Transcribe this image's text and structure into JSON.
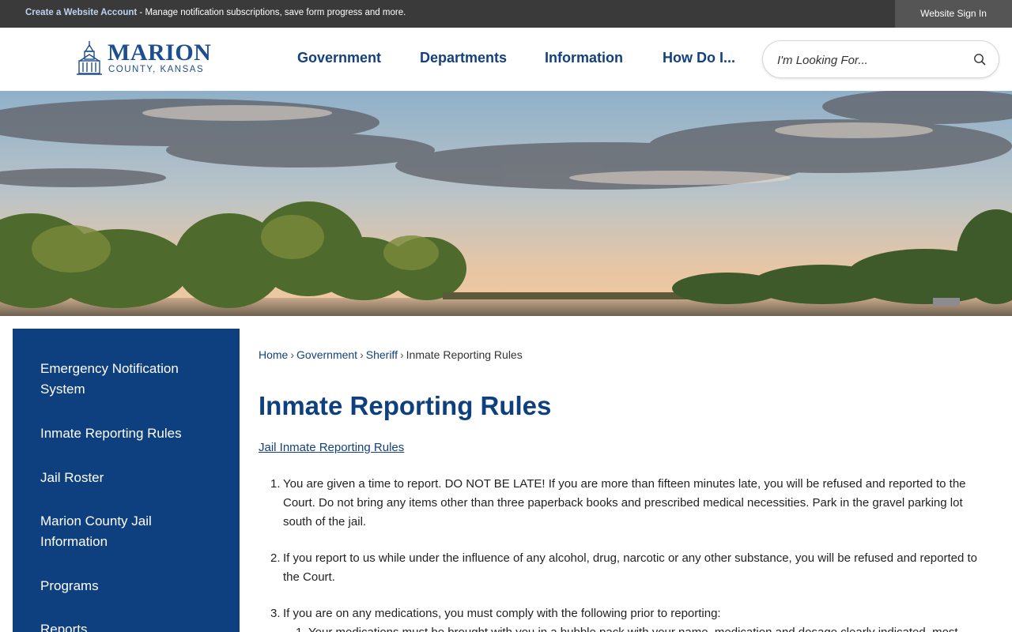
{
  "topbar": {
    "create_account_link": "Create a Website Account",
    "message": " - Manage notification subscriptions, save form progress and more.",
    "sign_in": "Website Sign In"
  },
  "header": {
    "logo_name": "MARION",
    "logo_subtitle": "COUNTY, KANSAS",
    "nav": [
      "Government",
      "Departments",
      "Information",
      "How Do I..."
    ],
    "search_placeholder": "I'm Looking For..."
  },
  "sidebar": {
    "items": [
      "Emergency Notification System",
      "Inmate Reporting Rules",
      "Jail Roster",
      "Marion County Jail Information",
      "Programs",
      "Reports"
    ]
  },
  "breadcrumb": {
    "items": [
      "Home",
      "Government",
      "Sheriff"
    ],
    "current": "Inmate Reporting Rules"
  },
  "main": {
    "title": "Inmate Reporting Rules",
    "link": "Jail Inmate Reporting Rules",
    "rules": [
      {
        "num": "1.",
        "text": "You are given a time to report. DO NOT BE LATE! If you are more than fifteen minutes late, you will be refused and reported to the Court. Do not bring any items other than three paperback books and prescribed medical necessities. Park in the gravel parking lot south of the jail."
      },
      {
        "num": "2.",
        "text": "If you report to us while under the influence of any alcohol, drug, narcotic or any other substance, you will be refused and reported to the Court."
      },
      {
        "num": "3.",
        "text": "If you are on any medications, you must comply with the following prior to reporting:"
      }
    ],
    "sub_rules": [
      {
        "num": "1.",
        "text": "Your medications must be brought with you in a bubble pack with your name, medication and dosage clearly indicated, most"
      }
    ]
  },
  "colors": {
    "topbar_bg": "#3a3a3a",
    "brand_blue": "#0e3f7e",
    "link_blue": "#13407e"
  }
}
